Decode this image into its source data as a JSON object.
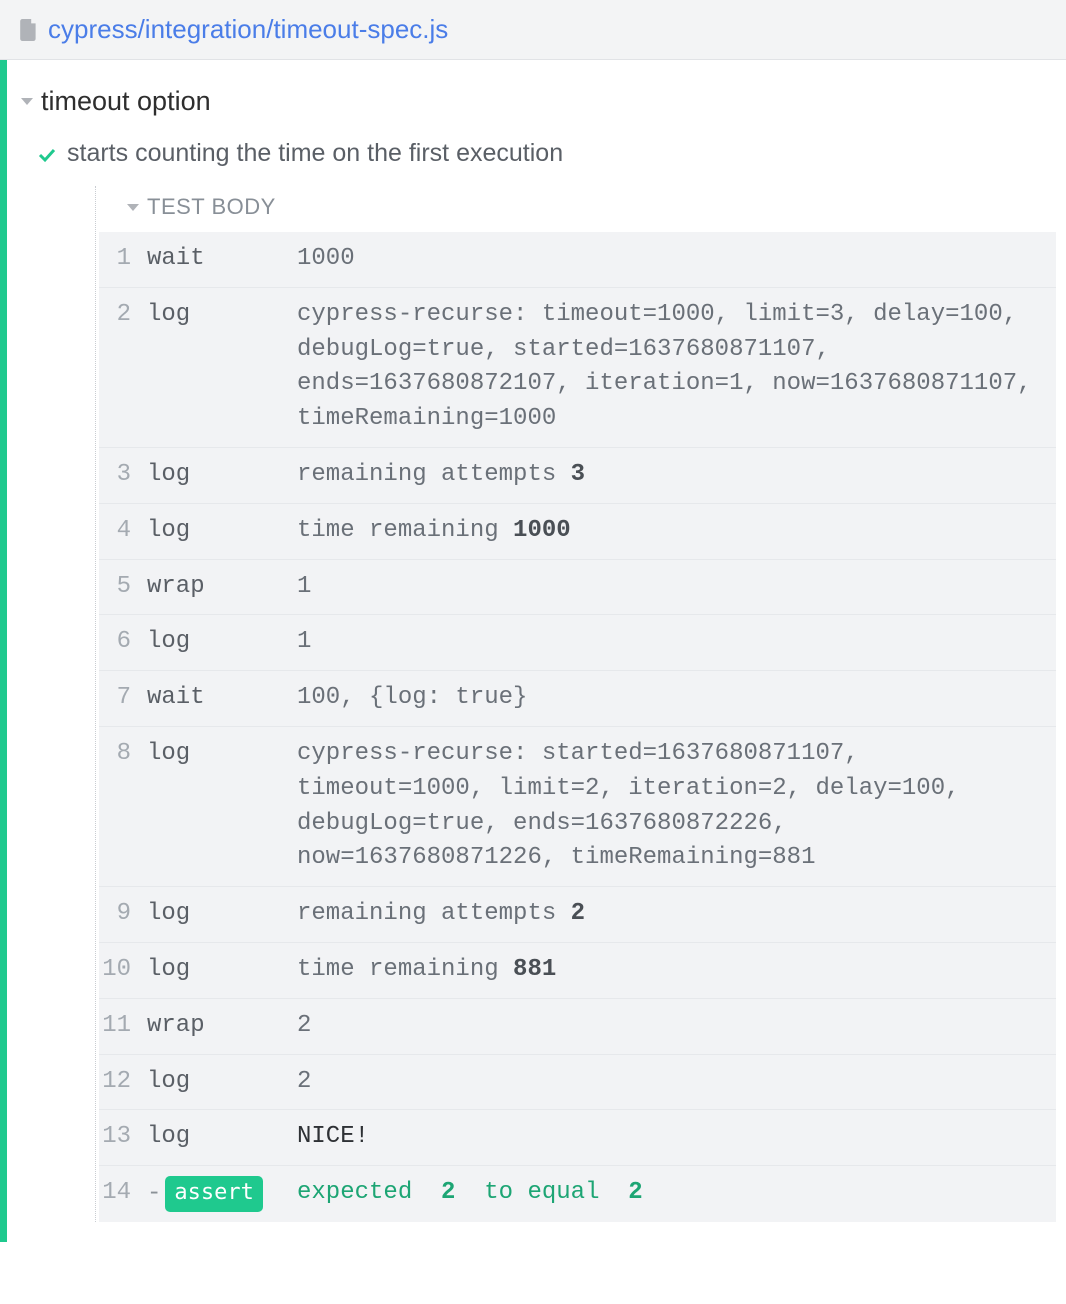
{
  "header": {
    "file_path": "cypress/integration/timeout-spec.js"
  },
  "suite": {
    "title": "timeout option"
  },
  "test": {
    "title": "starts counting the time on the first execution"
  },
  "body": {
    "label": "TEST BODY"
  },
  "commands": [
    {
      "num": "1",
      "name": "wait",
      "msg_plain": "1000"
    },
    {
      "num": "2",
      "name": "log",
      "msg_plain": "cypress-recurse: timeout=1000, limit=3, delay=100, debugLog=true, started=1637680871107, ends=1637680872107, iteration=1, now=1637680871107, timeRemaining=1000"
    },
    {
      "num": "3",
      "name": "log",
      "msg_pre": "remaining attempts ",
      "msg_bold": "3"
    },
    {
      "num": "4",
      "name": "log",
      "msg_pre": "time remaining ",
      "msg_bold": "1000"
    },
    {
      "num": "5",
      "name": "wrap",
      "msg_plain": "1"
    },
    {
      "num": "6",
      "name": "log",
      "msg_plain": "1"
    },
    {
      "num": "7",
      "name": "wait",
      "msg_plain": "100, {log: true}"
    },
    {
      "num": "8",
      "name": "log",
      "msg_plain": "cypress-recurse: started=1637680871107, timeout=1000, limit=2, iteration=2, delay=100, debugLog=true, ends=1637680872226, now=1637680871226, timeRemaining=881"
    },
    {
      "num": "9",
      "name": "log",
      "msg_pre": "remaining attempts ",
      "msg_bold": "2"
    },
    {
      "num": "10",
      "name": "log",
      "msg_pre": "time remaining ",
      "msg_bold": "881"
    },
    {
      "num": "11",
      "name": "wrap",
      "msg_plain": "2"
    },
    {
      "num": "12",
      "name": "log",
      "msg_plain": "2"
    },
    {
      "num": "13",
      "name": "log",
      "msg_dark": "NICE!"
    }
  ],
  "assert": {
    "num": "14",
    "dash": "-",
    "pill": "assert",
    "w1": "expected",
    "v1": "2",
    "w2": "to equal",
    "v2": "2"
  }
}
